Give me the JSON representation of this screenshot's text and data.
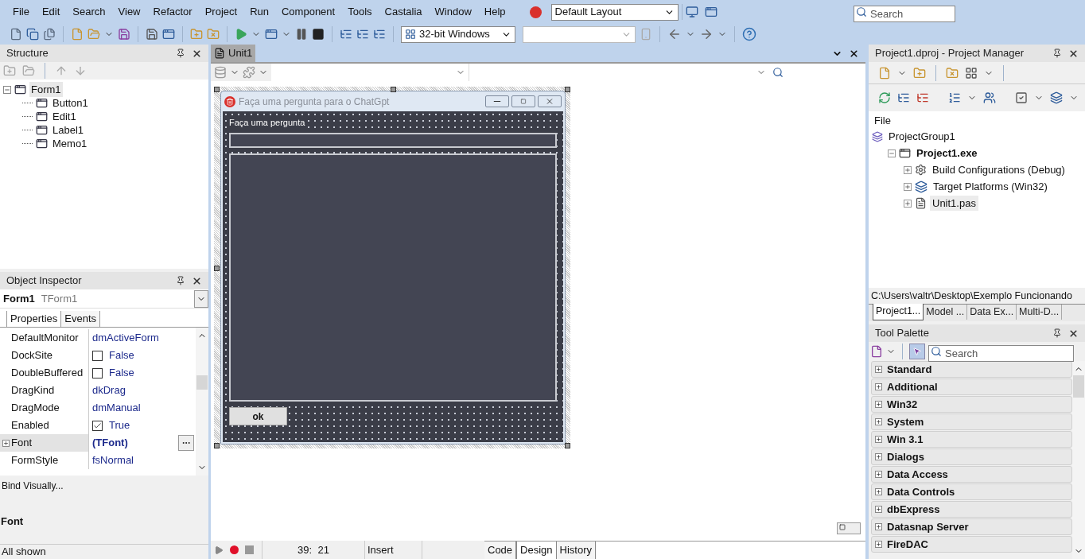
{
  "menu": [
    "File",
    "Edit",
    "Search",
    "View",
    "Refactor",
    "Project",
    "Run",
    "Component",
    "Tools",
    "Castalia",
    "Window",
    "Help"
  ],
  "layout_select": {
    "value": "Default Layout"
  },
  "search": {
    "placeholder": "Search"
  },
  "platform_select": {
    "value": "32-bit Windows"
  },
  "structure": {
    "title": "Structure",
    "tree": [
      {
        "label": "Form1",
        "selected": true,
        "expanded": true,
        "children": [
          {
            "label": "Button1",
            "selected": false
          },
          {
            "label": "Edit1",
            "selected": false
          },
          {
            "label": "Label1",
            "selected": false
          },
          {
            "label": "Memo1",
            "selected": false
          }
        ]
      }
    ]
  },
  "object_inspector": {
    "title": "Object Inspector",
    "object": "Form1",
    "type": "TForm1",
    "tabs": [
      {
        "label": "Properties",
        "selected": true
      },
      {
        "label": "Events",
        "selected": false
      }
    ],
    "properties": [
      {
        "name": "DefaultMonitor",
        "value": "dmActiveForm",
        "kind": "text",
        "selected": false
      },
      {
        "name": "DockSite",
        "value": "False",
        "kind": "check",
        "checked": false,
        "selected": false
      },
      {
        "name": "DoubleBuffered",
        "value": "False",
        "kind": "check",
        "checked": false,
        "selected": false
      },
      {
        "name": "DragKind",
        "value": "dkDrag",
        "kind": "text",
        "selected": false
      },
      {
        "name": "DragMode",
        "value": "dmManual",
        "kind": "text",
        "selected": false
      },
      {
        "name": "Enabled",
        "value": "True",
        "kind": "check",
        "checked": true,
        "selected": false
      },
      {
        "name": "Font",
        "value": "(TFont)",
        "kind": "object",
        "selected": true
      },
      {
        "name": "FormStyle",
        "value": "fsNormal",
        "kind": "text",
        "selected": false
      }
    ],
    "bind_link": "Bind Visually...",
    "description_title": "Font",
    "status": "All shown"
  },
  "editor": {
    "tab": "Unit1",
    "form": {
      "title": "Faça uma pergunta para o ChatGpt",
      "label": "Faça uma pergunta",
      "button": "ok"
    },
    "status": {
      "position": "39:  21",
      "mode": "Insert",
      "view_tabs": [
        {
          "label": "Code",
          "selected": false
        },
        {
          "label": "Design",
          "selected": true
        },
        {
          "label": "History",
          "selected": false
        }
      ]
    }
  },
  "project_manager": {
    "title": "Project1.dproj - Project Manager",
    "column": "File",
    "tree": [
      {
        "label": "ProjectGroup1",
        "kind": "group",
        "selected": false,
        "children": [
          {
            "label": "Project1.exe",
            "kind": "project",
            "selected": false,
            "expanded": true,
            "children": [
              {
                "label": "Build Configurations (Debug)",
                "kind": "config",
                "selected": false,
                "expanded": false
              },
              {
                "label": "Target Platforms (Win32)",
                "kind": "platforms",
                "selected": false,
                "expanded": false
              },
              {
                "label": "Unit1.pas",
                "kind": "file",
                "selected": true,
                "expanded": false
              }
            ]
          }
        ]
      }
    ],
    "path": "C:\\Users\\valtr\\Desktop\\Exemplo Funcionando",
    "tabs": [
      {
        "label": "Project1...",
        "selected": true
      },
      {
        "label": "Model ...",
        "selected": false
      },
      {
        "label": "Data Ex...",
        "selected": false
      },
      {
        "label": "Multi-D...",
        "selected": false
      }
    ]
  },
  "tool_palette": {
    "title": "Tool Palette",
    "search_placeholder": "Search",
    "categories": [
      "Standard",
      "Additional",
      "Win32",
      "System",
      "Win 3.1",
      "Dialogs",
      "Data Access",
      "Data Controls",
      "dbExpress",
      "Datasnap Server",
      "FireDAC"
    ]
  }
}
